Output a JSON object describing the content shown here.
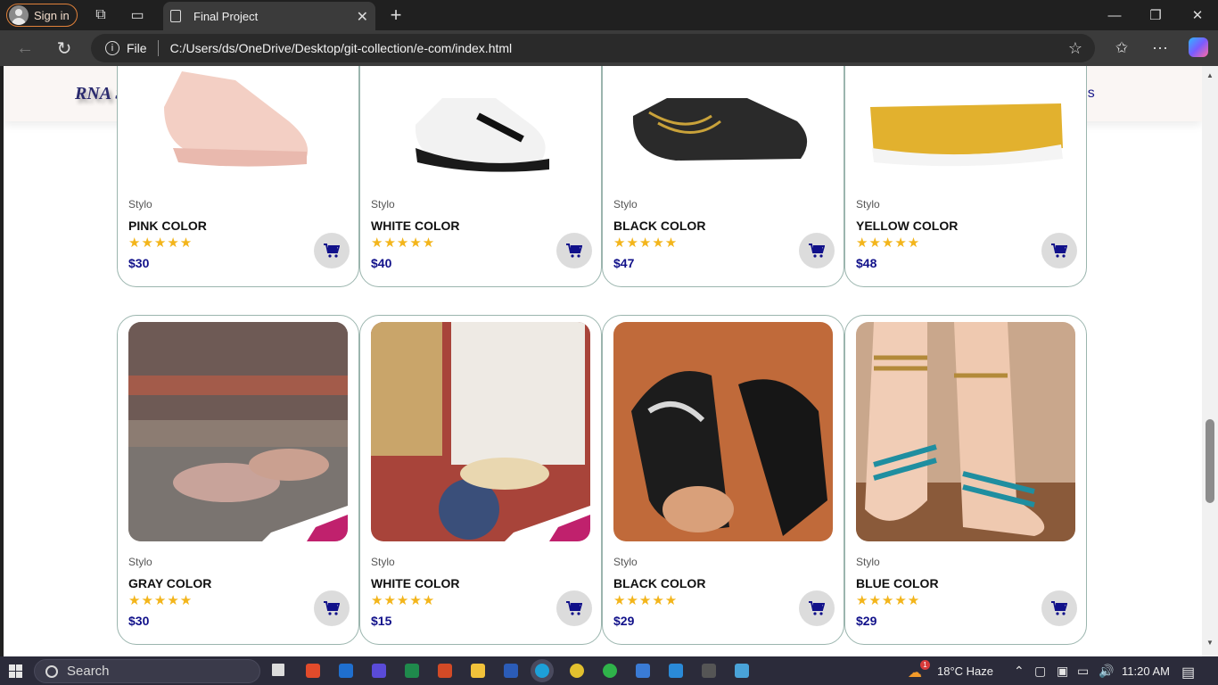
{
  "browser": {
    "signin_label": "Sign in",
    "tab_title": "Final Project",
    "omnibox_scheme": "File",
    "url": "C:/Users/ds/OneDrive/Desktop/git-collection/e-com/index.html"
  },
  "site": {
    "logo": "RNA SI",
    "nav_contact": "ct us"
  },
  "products_top": [
    {
      "brand": "Stylo",
      "name": "PINK COLOR",
      "stars": "★★★★★",
      "price": "$30",
      "photo_color": "#f3cfc4"
    },
    {
      "brand": "Stylo",
      "name": "WHITE COLOR",
      "stars": "★★★★★",
      "price": "$40",
      "photo_color": "#f2f2f2"
    },
    {
      "brand": "Stylo",
      "name": "BLACK COLOR",
      "stars": "★★★★★",
      "price": "$47",
      "photo_color": "#2a2a2a"
    },
    {
      "brand": "Stylo",
      "name": "YELLOW COLOR",
      "stars": "★★★★★",
      "price": "$48",
      "photo_color": "#e2b12e"
    }
  ],
  "products_bottom": [
    {
      "brand": "Stylo",
      "name": "GRAY COLOR",
      "stars": "★★★★★",
      "price": "$30",
      "photo_color": "#8c7c72"
    },
    {
      "brand": "Stylo",
      "name": "WHITE COLOR",
      "stars": "★★★★★",
      "price": "$15",
      "photo_color": "#a8443a"
    },
    {
      "brand": "Stylo",
      "name": "BLACK COLOR",
      "stars": "★★★★★",
      "price": "$29",
      "photo_color": "#c06a3a"
    },
    {
      "brand": "Stylo",
      "name": "BLUE COLOR",
      "stars": "★★★★★",
      "price": "$29",
      "photo_color": "#c9a78c"
    }
  ],
  "taskbar": {
    "search_label": "Search",
    "weather": "18°C  Haze",
    "time": "11:20 AM",
    "notification_count": "1"
  },
  "colors": {
    "accent_price": "#11118a",
    "star": "#f3b51b",
    "card_border": "#9bb5ae"
  }
}
